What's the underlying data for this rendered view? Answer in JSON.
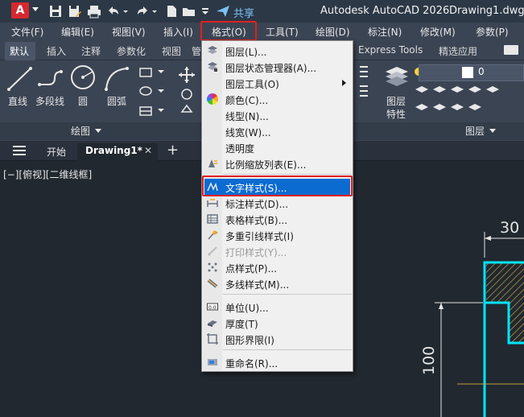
{
  "titlebar": {
    "logo": "A",
    "share_label": "共享",
    "app_title": "Autodesk AutoCAD 2026",
    "doc_title": "Drawing1.dwg",
    "quick_access": [
      "save-icon",
      "save-as-icon",
      "plot-icon",
      "undo-icon",
      "redo-icon",
      "new-icon",
      "open-icon",
      "overflow-icon",
      "share-icon"
    ]
  },
  "menubar": {
    "items": [
      "文件(F)",
      "编辑(E)",
      "视图(V)",
      "插入(I)",
      "格式(O)",
      "工具(T)",
      "绘图(D)",
      "标注(N)",
      "修改(M)",
      "参数(P)"
    ],
    "active": "格式(O)"
  },
  "ribbon_tabs": {
    "items": [
      "默认",
      "插入",
      "注释",
      "参数化",
      "视图",
      "管",
      "Express Tools",
      "精选应用"
    ],
    "active": "默认"
  },
  "ribbon": {
    "draw_tools": [
      "直线",
      "多段线",
      "圆",
      "圆弧"
    ],
    "draw_panel": "绘图",
    "layer_tools": [
      "图层",
      "特性"
    ],
    "layer_panel": "图层",
    "current_layer": "0",
    "layer_color": "#ffffff"
  },
  "file_tabs": {
    "start": "开始",
    "current": "Drawing1*",
    "close": "✕",
    "add": "+"
  },
  "viewport": {
    "view_label": "[−][俯视][二维线框]",
    "dim_top": "30",
    "dim_left": "100"
  },
  "format_menu": {
    "items": [
      {
        "label": "图层(L)...",
        "icon": "layer-icon",
        "disabled": false
      },
      {
        "label": "图层状态管理器(A)...",
        "icon": "layer-state-icon",
        "disabled": false
      },
      {
        "label": "图层工具(O)",
        "icon": "none",
        "disabled": false,
        "submenu": true
      },
      {
        "label": "颜色(C)...",
        "icon": "color-wheel-icon",
        "disabled": false
      },
      {
        "label": "线型(N)...",
        "icon": "none",
        "disabled": false
      },
      {
        "label": "线宽(W)...",
        "icon": "none",
        "disabled": false
      },
      {
        "label": "透明度",
        "icon": "none",
        "disabled": false
      },
      {
        "label": "比例缩放列表(E)...",
        "icon": "scale-list-icon",
        "disabled": false
      },
      {
        "label": "文字样式(S)...",
        "icon": "text-style-icon",
        "disabled": false,
        "highlighted": true
      },
      {
        "label": "标注样式(D)...",
        "icon": "dim-style-icon",
        "disabled": false
      },
      {
        "label": "表格样式(B)...",
        "icon": "table-style-icon",
        "disabled": false
      },
      {
        "label": "多重引线样式(I)",
        "icon": "mleader-style-icon",
        "disabled": false
      },
      {
        "label": "打印样式(Y)...",
        "icon": "plot-style-icon",
        "disabled": true
      },
      {
        "label": "点样式(P)...",
        "icon": "point-style-icon",
        "disabled": false
      },
      {
        "label": "多线样式(M)...",
        "icon": "mline-style-icon",
        "disabled": false
      },
      {
        "label": "单位(U)...",
        "icon": "units-icon",
        "disabled": false
      },
      {
        "label": "厚度(T)",
        "icon": "thickness-icon",
        "disabled": false
      },
      {
        "label": "图形界限(I)",
        "icon": "limits-icon",
        "disabled": false
      },
      {
        "label": "重命名(R)...",
        "icon": "rename-icon",
        "disabled": false
      }
    ]
  },
  "colors": {
    "accent": "#0c6bd1",
    "highlight_box": "#e02020",
    "share": "#7cc0f5",
    "hatch": "#c8a23a",
    "outline": "#00e5ff"
  }
}
